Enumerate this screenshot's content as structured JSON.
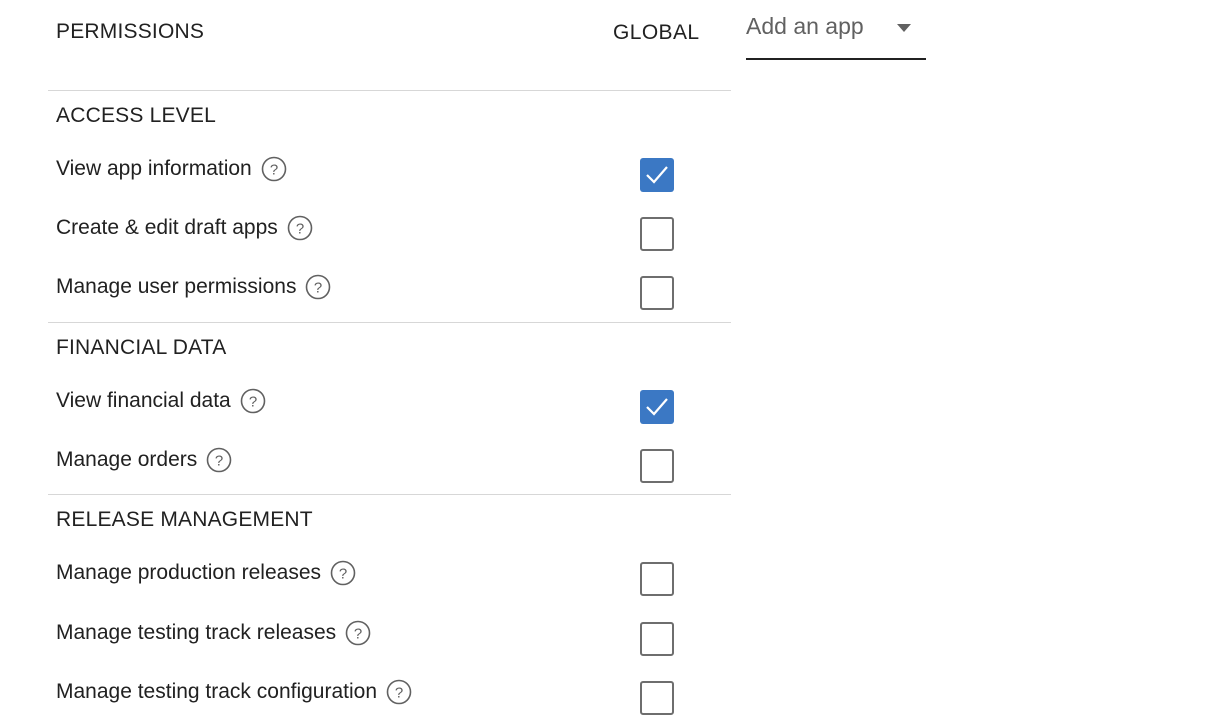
{
  "header": {
    "permissions_label": "PERMISSIONS",
    "global_label": "GLOBAL",
    "app_select": {
      "label": "Add an app",
      "icon": "caret-down-icon"
    }
  },
  "colors": {
    "checkbox_checked": "#3b78c4",
    "checkbox_unchecked_border": "#6e6e6e",
    "divider": "#d7d7d7"
  },
  "sections": [
    {
      "title": "ACCESS LEVEL",
      "permissions": [
        {
          "label": "View app information",
          "checked": true
        },
        {
          "label": "Create & edit draft apps",
          "checked": false
        },
        {
          "label": "Manage user permissions",
          "checked": false
        }
      ]
    },
    {
      "title": "FINANCIAL DATA",
      "permissions": [
        {
          "label": "View financial data",
          "checked": true
        },
        {
          "label": "Manage orders",
          "checked": false
        }
      ]
    },
    {
      "title": "RELEASE MANAGEMENT",
      "permissions": [
        {
          "label": "Manage production releases",
          "checked": false
        },
        {
          "label": "Manage testing track releases",
          "checked": false
        },
        {
          "label": "Manage testing track configuration",
          "checked": false
        }
      ]
    }
  ]
}
